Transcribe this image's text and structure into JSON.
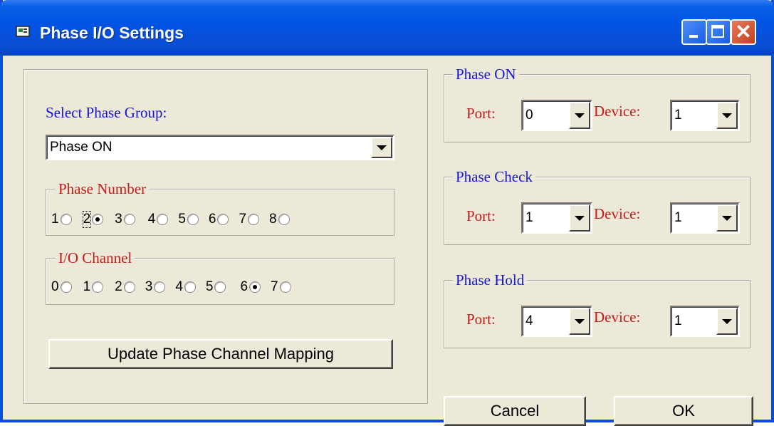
{
  "window": {
    "title": "Phase I/O Settings"
  },
  "select_group": {
    "label": "Select Phase Group:",
    "value": "Phase ON"
  },
  "phase_number": {
    "legend": "Phase Number",
    "options": [
      "1",
      "2",
      "3",
      "4",
      "5",
      "6",
      "7",
      "8"
    ],
    "selected": "2"
  },
  "io_channel": {
    "legend": "I/O Channel",
    "options": [
      "0",
      "1",
      "2",
      "3",
      "4",
      "5",
      "6",
      "7"
    ],
    "selected": "6"
  },
  "update_button": "Update Phase Channel Mapping",
  "groups": [
    {
      "title": "Phase ON",
      "port_label": "Port:",
      "port": "0",
      "device_label": "Device:",
      "device": "1"
    },
    {
      "title": "Phase Check",
      "port_label": "Port:",
      "port": "1",
      "device_label": "Device:",
      "device": "1"
    },
    {
      "title": "Phase Hold",
      "port_label": "Port:",
      "port": "4",
      "device_label": "Device:",
      "device": "1"
    }
  ],
  "cancel_button": "Cancel",
  "ok_button": "OK",
  "colors": {
    "title_bar": "#0054e3",
    "label_blue": "#1616d4",
    "label_red": "#c41a1a",
    "dialog_bg": "#ece9d8"
  }
}
